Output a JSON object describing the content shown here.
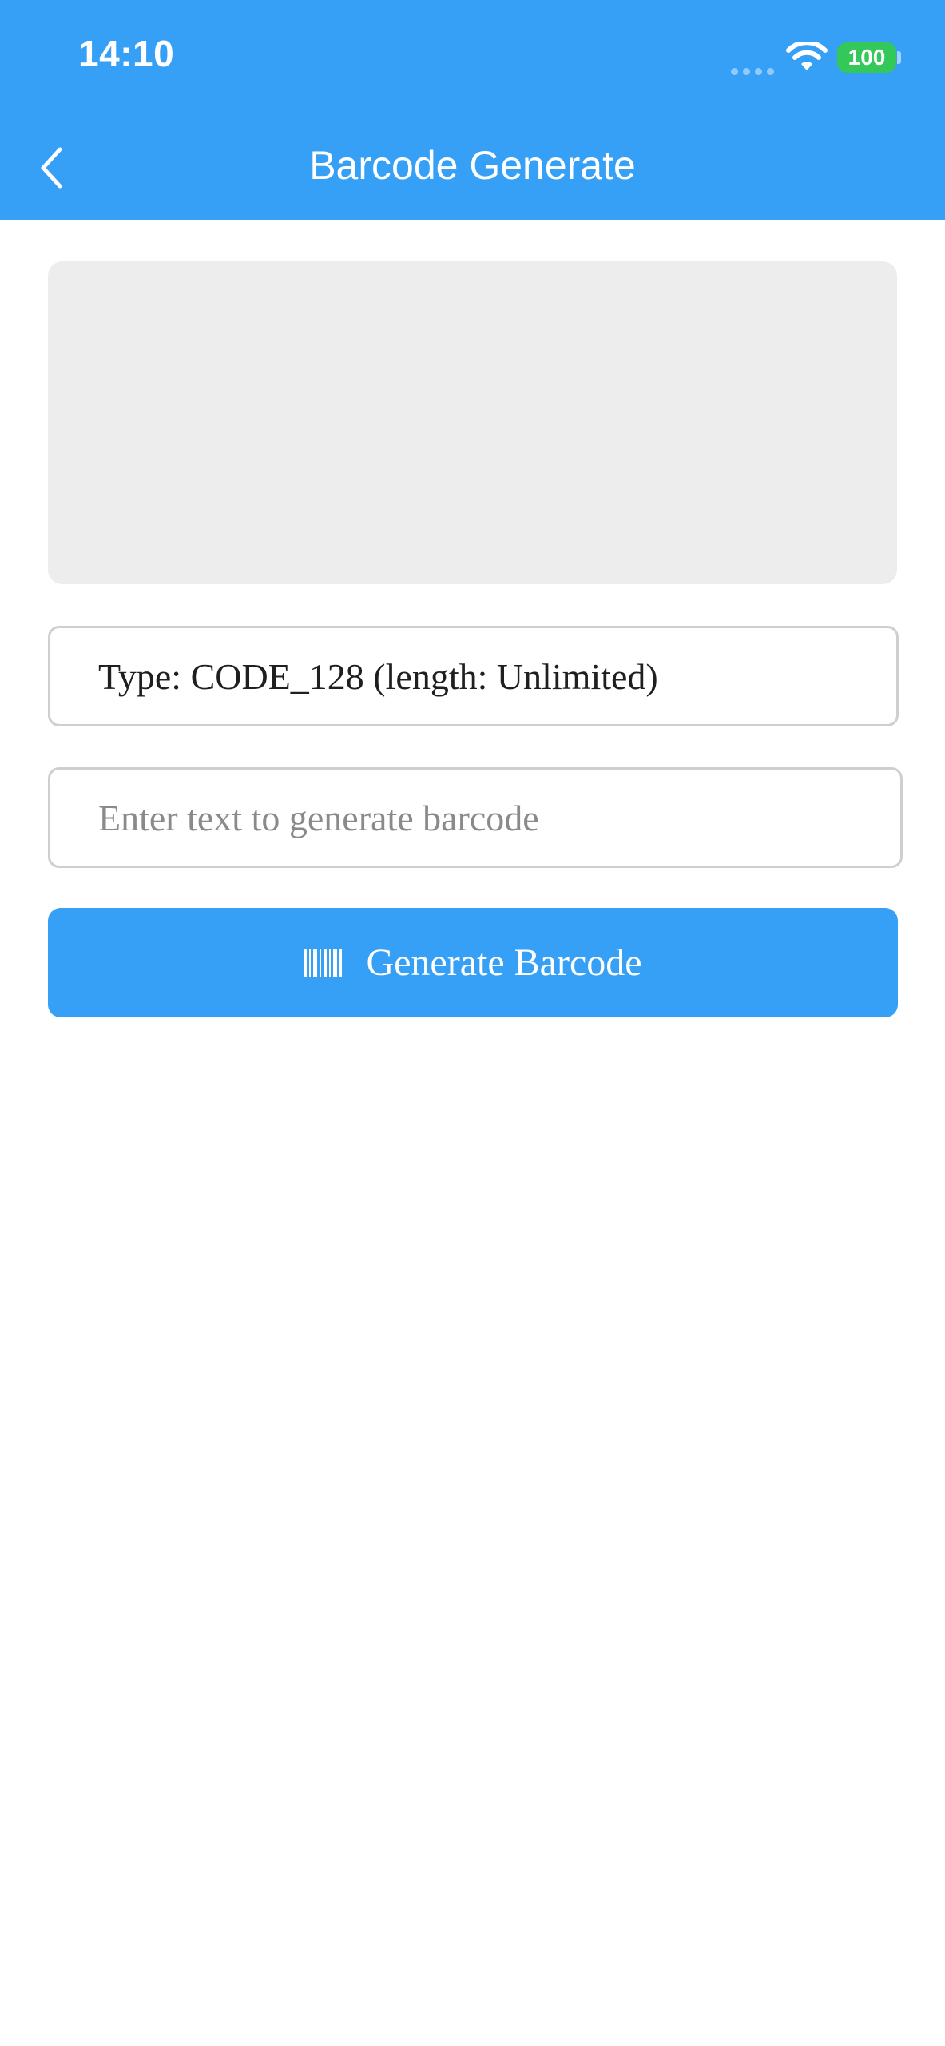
{
  "status_bar": {
    "time": "14:10",
    "battery": "100"
  },
  "nav": {
    "title": "Barcode Generate"
  },
  "barcode_type": {
    "label": "Type: CODE_128 (length: Unlimited)"
  },
  "input": {
    "placeholder": "Enter text to generate barcode",
    "value": ""
  },
  "generate_button": {
    "label": "Generate Barcode",
    "icon": "barcode-icon"
  },
  "colors": {
    "accent": "#36A0F7",
    "battery": "#34C759",
    "preview_bg": "#EDEDED",
    "border": "#CFCFCF"
  }
}
